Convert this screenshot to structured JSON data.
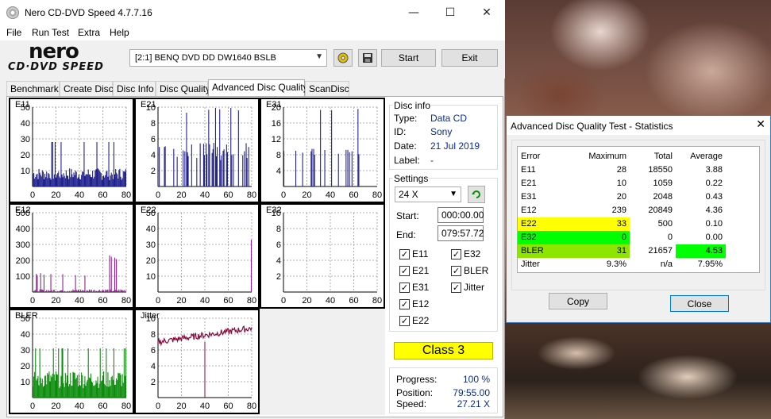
{
  "window": {
    "title": "Nero CD-DVD Speed 4.7.7.16",
    "minimize": "—",
    "maximize": "☐",
    "close": "✕"
  },
  "menu": [
    "File",
    "Run Test",
    "Extra",
    "Help"
  ],
  "logo": {
    "top": "nero",
    "bottom": "CD·DVD SPEED"
  },
  "toolbar": {
    "drive": "[2:1]   BENQ DVD DD DW1640 BSLB",
    "start_label": "Start",
    "exit_label": "Exit"
  },
  "tabs": [
    "Benchmark",
    "Create Disc",
    "Disc Info",
    "Disc Quality",
    "Advanced Disc Quality",
    "ScanDisc"
  ],
  "active_tab": "Advanced Disc Quality",
  "disc_info": {
    "group_label": "Disc info",
    "type_label": "Type:",
    "type": "Data CD",
    "id_label": "ID:",
    "id": "Sony",
    "date_label": "Date:",
    "date": "21 Jul 2019",
    "label_label": "Label:",
    "label": "-"
  },
  "settings": {
    "group_label": "Settings",
    "speed": "24 X",
    "start_label": "Start:",
    "start": "000:00.00",
    "end_label": "End:",
    "end": "079:57.72",
    "checks": [
      {
        "label": "E11",
        "checked": true
      },
      {
        "label": "E32",
        "checked": true
      },
      {
        "label": "E21",
        "checked": true
      },
      {
        "label": "BLER",
        "checked": true
      },
      {
        "label": "E31",
        "checked": true
      },
      {
        "label": "Jitter",
        "checked": true
      },
      {
        "label": "E12",
        "checked": true
      },
      {
        "label": "E22",
        "checked": true
      }
    ]
  },
  "class": "Class 3",
  "progress": {
    "progress_label": "Progress:",
    "progress": "100 %",
    "position_label": "Position:",
    "position": "79:55.00",
    "speed_label": "Speed:",
    "speed": "27.21 X"
  },
  "stats": {
    "title": "Advanced Disc Quality Test - Statistics",
    "headers": [
      "Error",
      "Maximum",
      "Total",
      "Average"
    ],
    "rows": [
      [
        "E11",
        "28",
        "18550",
        "3.88"
      ],
      [
        "E21",
        "10",
        "1059",
        "0.22"
      ],
      [
        "E31",
        "20",
        "2048",
        "0.43"
      ],
      [
        "E12",
        "239",
        "20849",
        "4.36"
      ],
      [
        "E22",
        "33",
        "500",
        "0.10"
      ],
      [
        "E32",
        "0",
        "0",
        "0.00"
      ],
      [
        "BLER",
        "31",
        "21657",
        "4.53"
      ],
      [
        "Jitter",
        "9.3%",
        "n/a",
        "7.95%"
      ]
    ],
    "copy_label": "Copy",
    "close_label": "Close"
  },
  "colors": {
    "e_series": "#1e1e8c",
    "e12_series": "#8c1e8c",
    "bler_series": "#0a8c0a",
    "jitter_series": "#8c0a3c",
    "class_bg": "#ffff00",
    "highlight_yellow": "#ffff00",
    "highlight_green": "#00ff00",
    "highlight_lime": "#8ee600"
  },
  "chart_data": [
    {
      "type": "bar",
      "title": "E11",
      "x": [
        0,
        80
      ],
      "ylim": [
        0,
        50
      ],
      "yticks": [
        10,
        20,
        30,
        40,
        50
      ],
      "xticks": [
        0,
        20,
        40,
        60,
        80
      ],
      "max": 28
    },
    {
      "type": "bar",
      "title": "E21",
      "x": [
        0,
        80
      ],
      "ylim": [
        0,
        10
      ],
      "yticks": [
        2,
        4,
        6,
        8,
        10
      ],
      "xticks": [
        0,
        20,
        40,
        60,
        80
      ],
      "max": 10
    },
    {
      "type": "bar",
      "title": "E31",
      "x": [
        0,
        80
      ],
      "ylim": [
        0,
        20
      ],
      "yticks": [
        4,
        8,
        12,
        16,
        20
      ],
      "xticks": [
        0,
        20,
        40,
        60,
        80
      ],
      "max": 20
    },
    {
      "type": "bar",
      "title": "E12",
      "x": [
        0,
        80
      ],
      "ylim": [
        0,
        500
      ],
      "yticks": [
        100,
        200,
        300,
        400,
        500
      ],
      "xticks": [
        0,
        20,
        40,
        60,
        80
      ],
      "max": 239
    },
    {
      "type": "bar",
      "title": "E22",
      "x": [
        0,
        80
      ],
      "ylim": [
        0,
        50
      ],
      "yticks": [
        10,
        20,
        30,
        40,
        50
      ],
      "xticks": [
        0,
        20,
        40,
        60,
        80
      ],
      "max": 33
    },
    {
      "type": "bar",
      "title": "E32",
      "x": [
        0,
        80
      ],
      "ylim": [
        0,
        10
      ],
      "yticks": [
        2,
        4,
        6,
        8,
        10
      ],
      "xticks": [
        0,
        20,
        40,
        60,
        80
      ],
      "max": 0
    },
    {
      "type": "bar",
      "title": "BLER",
      "x": [
        0,
        80
      ],
      "ylim": [
        0,
        50
      ],
      "yticks": [
        10,
        20,
        30,
        40,
        50
      ],
      "xticks": [
        0,
        20,
        40,
        60,
        80
      ],
      "max": 31
    },
    {
      "type": "line",
      "title": "Jitter",
      "x": [
        0,
        80
      ],
      "ylim": [
        0,
        10
      ],
      "yticks": [
        2,
        4,
        6,
        8,
        10
      ],
      "xticks": [
        0,
        20,
        40,
        60,
        80
      ],
      "max": 9.3,
      "avg": 7.95
    }
  ]
}
